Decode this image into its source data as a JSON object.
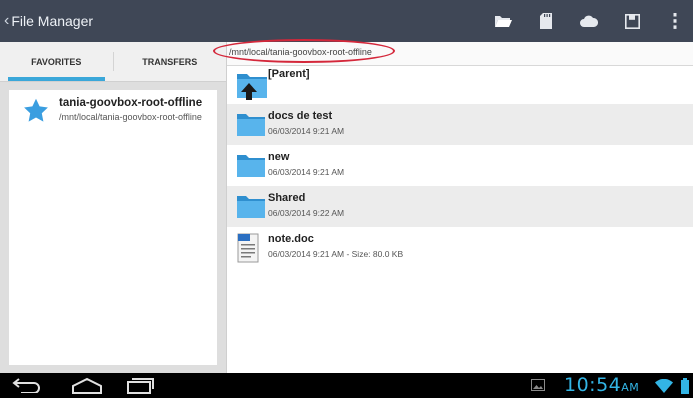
{
  "actionbar": {
    "back_glyph": "‹",
    "title": "File Manager",
    "icons": [
      "folder-open-icon",
      "sd-card-icon",
      "cloud-icon",
      "save-icon",
      "overflow-menu-icon"
    ]
  },
  "tabs": {
    "favorites": "FAVORITES",
    "transfers": "TRANSFERS"
  },
  "favorites": [
    {
      "name": "tania-goovbox-root-offline",
      "path": "/mnt/local/tania-goovbox-root-offline"
    }
  ],
  "path_bar": {
    "path": "/mnt/local/tania-goovbox-root-offline",
    "highlight_color": "#d4273a"
  },
  "files": {
    "parent": {
      "name": "[Parent]"
    },
    "items": [
      {
        "name": "docs de test",
        "meta": "06/03/2014 9:21 AM",
        "type": "folder"
      },
      {
        "name": "new",
        "meta": "06/03/2014 9:21 AM",
        "type": "folder"
      },
      {
        "name": "Shared",
        "meta": "06/03/2014 9:22 AM",
        "type": "folder"
      },
      {
        "name": "note.doc",
        "meta": "06/03/2014 9:21 AM - Size: 80.0 KB",
        "type": "document"
      }
    ]
  },
  "systembar": {
    "time": "10:54",
    "ampm": "AM",
    "accent": "#33b5e5"
  }
}
